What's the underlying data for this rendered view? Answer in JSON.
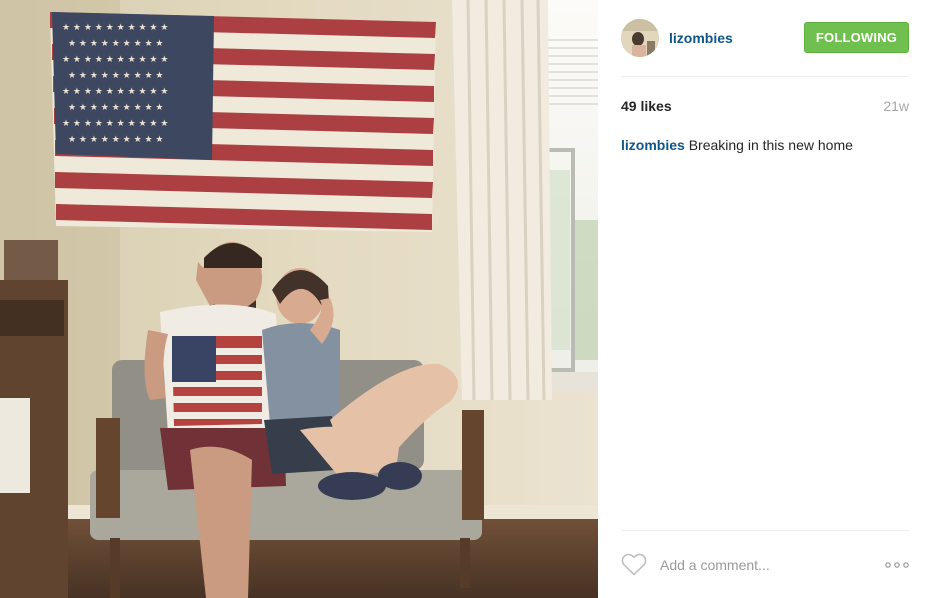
{
  "post": {
    "username": "lizombies",
    "follow_label": "FOLLOWING",
    "likes_text": "49 likes",
    "age_text": "21w",
    "caption": {
      "username": "lizombies",
      "text": "Breaking in this new home"
    }
  },
  "comment": {
    "placeholder": "Add a comment..."
  },
  "icons": {
    "like": "heart-outline-icon",
    "options": "more-options-icon"
  },
  "colors": {
    "username_link": "#125688",
    "follow_button": "#70c050",
    "muted_text": "#a5a7aa",
    "divider": "#efefef"
  }
}
